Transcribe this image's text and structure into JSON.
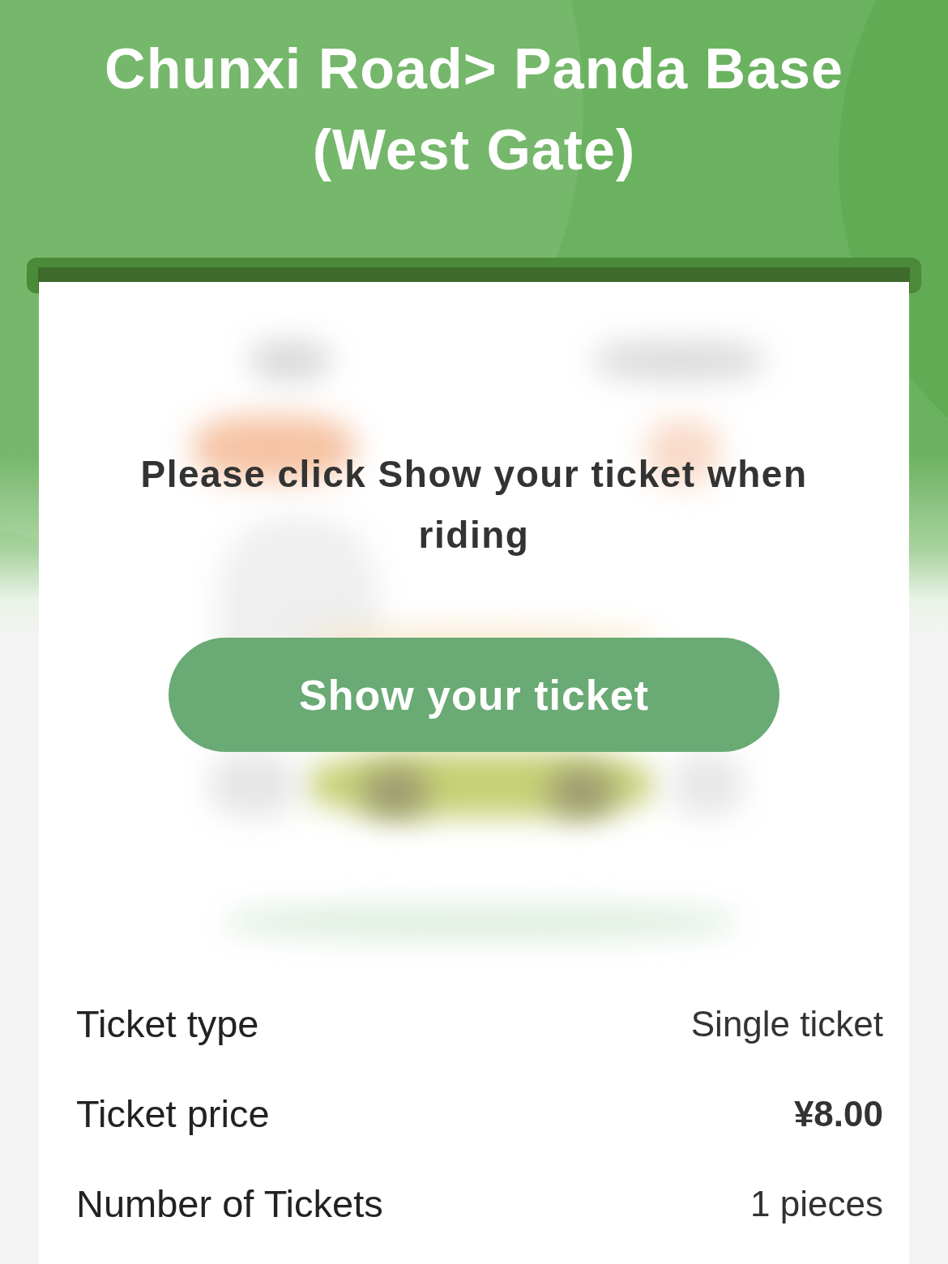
{
  "header": {
    "title": "Chunxi Road> Panda Base (West Gate)"
  },
  "ticket": {
    "notice": "Please click Show your ticket when riding",
    "button": "Show your ticket"
  },
  "details": [
    {
      "label": "Ticket type",
      "value": "Single ticket",
      "kind": "plain"
    },
    {
      "label": "Ticket price",
      "value": "¥8.00",
      "kind": "amount"
    },
    {
      "label": "Number of Tickets",
      "value": "1 pieces",
      "kind": "plain"
    }
  ]
}
